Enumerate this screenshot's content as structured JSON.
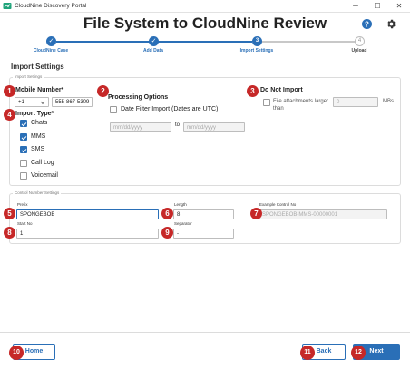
{
  "window": {
    "title": "CloudNine Discovery Portal",
    "minimize_glyph": "─",
    "maximize_glyph": "☐",
    "close_glyph": "✕"
  },
  "page": {
    "title": "File System to CloudNine Review",
    "help_icon_glyph": "?"
  },
  "stepper": {
    "steps": [
      {
        "label": "CloudNine Case",
        "state": "done",
        "glyph": "✓"
      },
      {
        "label": "Add Data",
        "state": "done",
        "glyph": "✓"
      },
      {
        "label": "Import Settings",
        "state": "active",
        "glyph": "3"
      },
      {
        "label": "Upload",
        "state": "pending",
        "glyph": "4"
      }
    ]
  },
  "section_title": "Import Settings",
  "import_settings": {
    "legend": "Import Settings",
    "mobile_number_label": "Mobile Number*",
    "country_code": "+1",
    "phone_value": "555-867-5309",
    "import_type_label": "Import Type*",
    "import_types": [
      {
        "label": "Chats",
        "checked": true
      },
      {
        "label": "MMS",
        "checked": true
      },
      {
        "label": "SMS",
        "checked": true
      },
      {
        "label": "Call Log",
        "checked": false
      },
      {
        "label": "Voicemail",
        "checked": false
      }
    ],
    "processing_options_label": "Processing Options",
    "date_filter_label": "Date Filter Import (Dates are UTC)",
    "date_from_placeholder": "mm/dd/yyyy",
    "date_to_label": "to",
    "date_to_placeholder": "mm/dd/yyyy",
    "do_not_import_label": "Do Not Import",
    "file_attachments_label_1": "File attachments larger",
    "file_attachments_label_2": "than",
    "attachment_size_value": "0",
    "attachment_unit": "MBs"
  },
  "control_number": {
    "legend": "Control Number Settings",
    "prefix_label": "Prefix",
    "prefix_value": "SPONGEBOB",
    "length_label": "Length",
    "length_value": "8",
    "example_label": "Example Control No",
    "example_value": "SPONGEBOB-MMS-00000001",
    "start_no_label": "Start No",
    "start_no_value": "1",
    "separator_label": "Separator",
    "separator_value": "-"
  },
  "footer": {
    "home_label": "Home",
    "back_label": "Back",
    "next_label": "Next"
  },
  "callouts": [
    "1",
    "2",
    "3",
    "4",
    "5",
    "6",
    "7",
    "8",
    "9",
    "10",
    "11",
    "12"
  ],
  "colors": {
    "accent": "#2a6fb7",
    "callout": "#c62828",
    "step_done": "#2a6fb7",
    "step_pending": "#bdbdbd"
  }
}
